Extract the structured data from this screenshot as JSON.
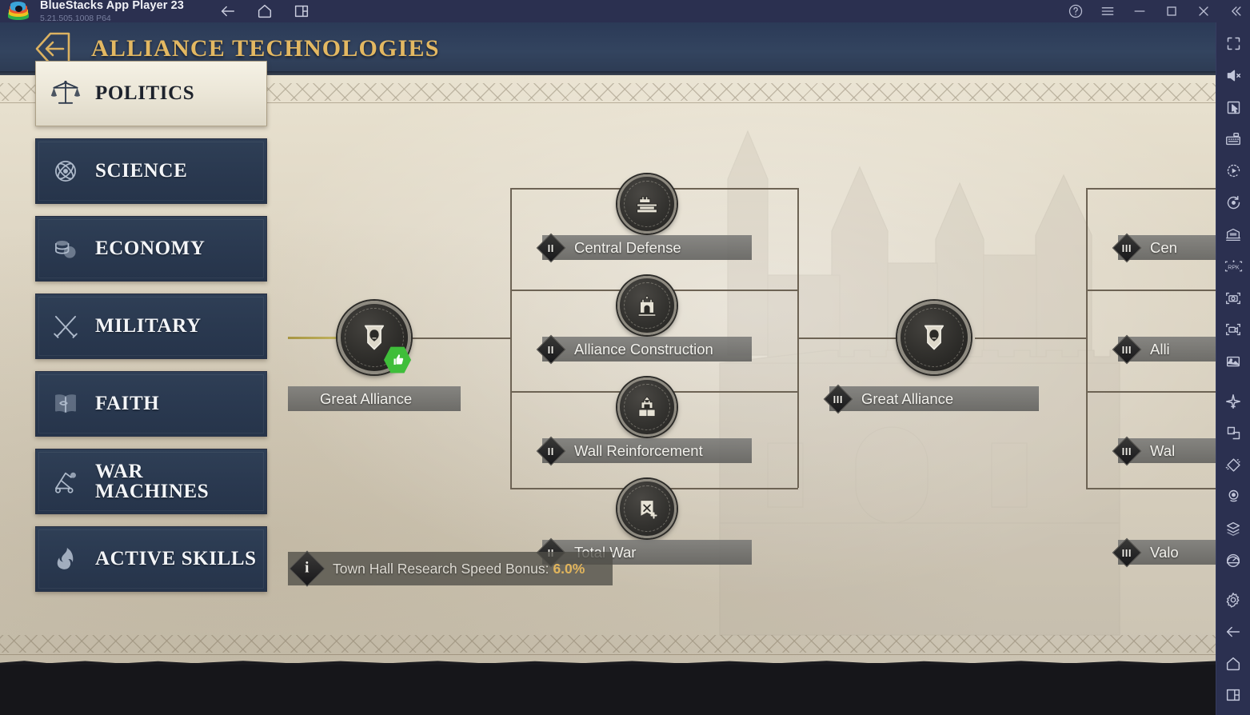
{
  "window": {
    "app_title": "BlueStacks App Player 23",
    "version": "5.21.505.1008  P64",
    "nav": [
      {
        "name": "back-arrow-icon",
        "label": "Back"
      },
      {
        "name": "home-icon",
        "label": "Home"
      },
      {
        "name": "multi-instance-icon",
        "label": "Instances"
      }
    ],
    "controls": [
      {
        "name": "help-icon",
        "label": "Help"
      },
      {
        "name": "menu-icon",
        "label": "Menu"
      },
      {
        "name": "minimize-icon",
        "label": "Minimize"
      },
      {
        "name": "maximize-icon",
        "label": "Maximize"
      },
      {
        "name": "close-icon",
        "label": "Close"
      },
      {
        "name": "collapse-icon",
        "label": "Collapse"
      }
    ]
  },
  "toolbar_right": [
    {
      "name": "fullscreen-icon",
      "label": "Fullscreen"
    },
    {
      "name": "mute-icon",
      "label": "Mute"
    },
    {
      "name": "cursor-icon",
      "label": "Cursor"
    },
    {
      "name": "keyboard-icon",
      "label": "Game controls"
    },
    {
      "name": "macro-play-icon",
      "label": "Macros"
    },
    {
      "name": "script-icon",
      "label": "Script"
    },
    {
      "name": "real-time-translation-icon",
      "label": "Real-time translation"
    },
    {
      "name": "rpk-icon",
      "label": "RPK"
    },
    {
      "name": "screenshot-icon",
      "label": "Screenshot"
    },
    {
      "name": "record-video-icon",
      "label": "Record video"
    },
    {
      "name": "media-manager-icon",
      "label": "Media manager"
    },
    {
      "name": "eco-mode-icon",
      "label": "Eco mode"
    },
    {
      "name": "multi-instance-manager-icon",
      "label": "Multi-instance manager"
    },
    {
      "name": "shake-icon",
      "label": "Shake"
    },
    {
      "name": "location-icon",
      "label": "Location"
    },
    {
      "name": "layers-icon",
      "label": "Layers"
    },
    {
      "name": "performance-icon",
      "label": "Performance"
    },
    {
      "name": "settings-gear-icon",
      "label": "Settings"
    },
    {
      "name": "android-back-icon",
      "label": "Back"
    },
    {
      "name": "android-home-icon",
      "label": "Home"
    },
    {
      "name": "android-recents-icon",
      "label": "Recents"
    }
  ],
  "game": {
    "header": {
      "back_button": "back-hex-icon",
      "title": "ALLIANCE TECHNOLOGIES"
    },
    "categories": [
      {
        "label": "POLITICS",
        "icon": "scales-icon",
        "active": true
      },
      {
        "label": "SCIENCE",
        "icon": "atom-icon",
        "active": false
      },
      {
        "label": "ECONOMY",
        "icon": "coins-icon",
        "active": false
      },
      {
        "label": "MILITARY",
        "icon": "swords-icon",
        "active": false
      },
      {
        "label": "FAITH",
        "icon": "book-icon",
        "active": false
      },
      {
        "label": "WAR MACHINES",
        "icon": "catapult-icon",
        "active": false,
        "line1": "WAR",
        "line2": "MACHINES"
      },
      {
        "label": "ACTIVE SKILLS",
        "icon": "flame-icon",
        "active": false
      }
    ],
    "tech_nodes": [
      {
        "id": "great-alliance-2",
        "label": "Great Alliance",
        "tier": "",
        "icon": "alliance-crest-icon",
        "badge": "thumbs-up",
        "column": 1
      },
      {
        "id": "central-defense",
        "label": "Central Defense",
        "tier": "II",
        "icon": "fortress-icon",
        "column": 2
      },
      {
        "id": "alliance-construction",
        "label": "Alliance Construction",
        "tier": "II",
        "icon": "castle-icon",
        "column": 2
      },
      {
        "id": "wall-reinforcement",
        "label": "Wall Reinforcement",
        "tier": "II",
        "icon": "wall-icon",
        "column": 2
      },
      {
        "id": "total-war",
        "label": "Total War",
        "tier": "II",
        "icon": "banner-swords-icon",
        "column": 2
      },
      {
        "id": "great-alliance-3",
        "label": "Great Alliance",
        "tier": "III",
        "icon": "alliance-crest-icon",
        "column": 3
      },
      {
        "id": "central-defense-3",
        "label": "Cen",
        "tier": "III",
        "column": 4,
        "truncated": true
      },
      {
        "id": "alliance-construction-3",
        "label": "Alli",
        "tier": "III",
        "column": 4,
        "truncated": true
      },
      {
        "id": "wall-reinforcement-3",
        "label": "Wal",
        "tier": "III",
        "column": 4,
        "truncated": true
      },
      {
        "id": "valor-3",
        "label": "Valo",
        "tier": "III",
        "column": 4,
        "truncated": true
      }
    ],
    "info_bar": {
      "icon": "info-icon",
      "text": "Town Hall Research Speed Bonus:",
      "value": "6.0%"
    }
  },
  "colors": {
    "gold": "#e3b862",
    "header_blue": "#2f3e59",
    "sidebar_navy": "#2a3950",
    "parchment": "#ded6c4",
    "accent_green": "#3fbe3a",
    "bonus_value": "#e0b45c"
  }
}
